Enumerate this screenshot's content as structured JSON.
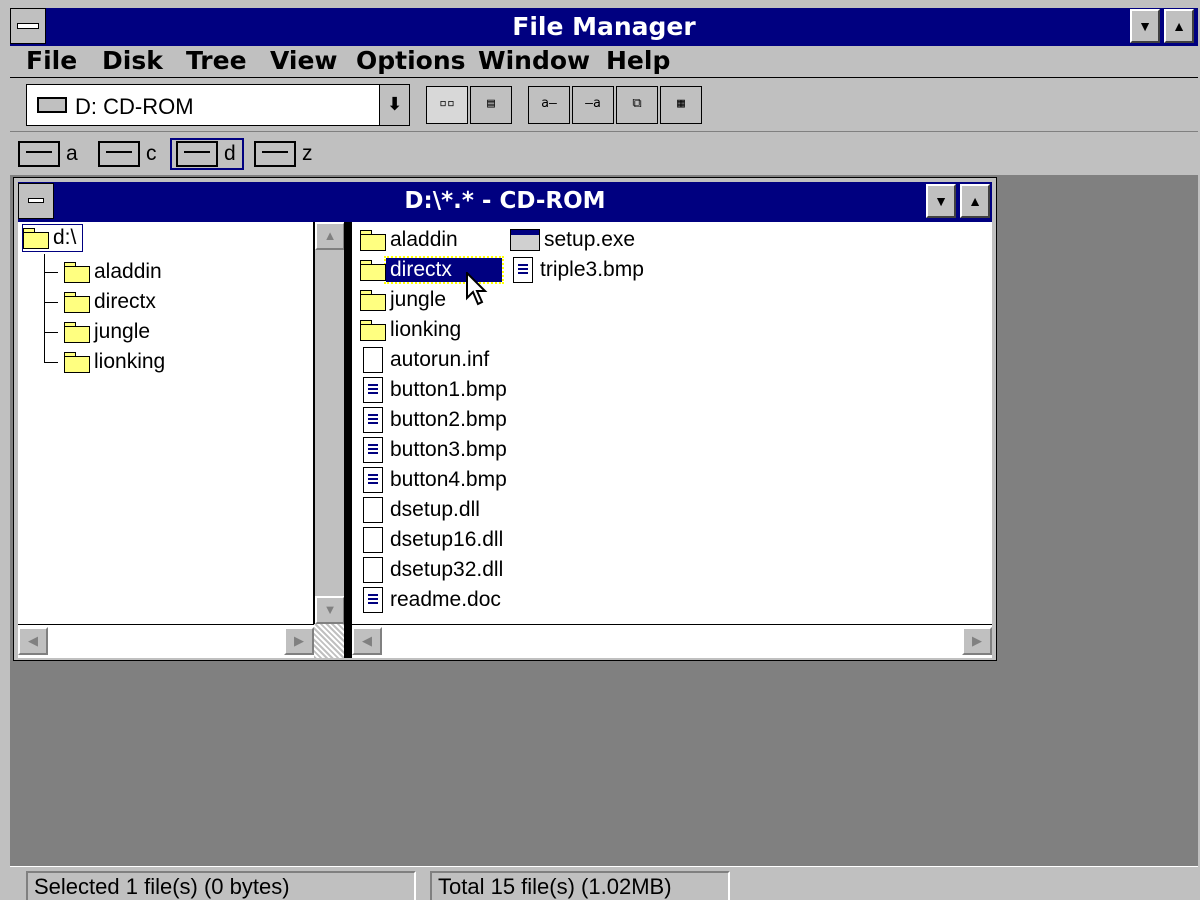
{
  "window": {
    "title": "File Manager"
  },
  "menu": [
    "File",
    "Disk",
    "Tree",
    "View",
    "Options",
    "Window",
    "Help"
  ],
  "toolbar": {
    "drive_select": "D: CD-ROM"
  },
  "drives": [
    {
      "letter": "a",
      "type": "floppy"
    },
    {
      "letter": "c",
      "type": "hard-disk"
    },
    {
      "letter": "d",
      "type": "cd-rom",
      "selected": true
    },
    {
      "letter": "z",
      "type": "network"
    }
  ],
  "child_window": {
    "title": "D:\\*.* - CD-ROM",
    "tree": {
      "root": "d:\\",
      "children": [
        "aladdin",
        "directx",
        "jungle",
        "lionking"
      ]
    },
    "files_col1": [
      {
        "name": "aladdin",
        "icon": "folder-icon"
      },
      {
        "name": "directx",
        "icon": "folder-icon",
        "selected": true
      },
      {
        "name": "jungle",
        "icon": "folder-icon"
      },
      {
        "name": "lionking",
        "icon": "folder-icon"
      },
      {
        "name": "autorun.inf",
        "icon": "file-icon"
      },
      {
        "name": "button1.bmp",
        "icon": "document-icon"
      },
      {
        "name": "button2.bmp",
        "icon": "document-icon"
      },
      {
        "name": "button3.bmp",
        "icon": "document-icon"
      },
      {
        "name": "button4.bmp",
        "icon": "document-icon"
      },
      {
        "name": "dsetup.dll",
        "icon": "file-icon"
      },
      {
        "name": "dsetup16.dll",
        "icon": "file-icon"
      },
      {
        "name": "dsetup32.dll",
        "icon": "file-icon"
      },
      {
        "name": "readme.doc",
        "icon": "document-icon"
      }
    ],
    "files_col2": [
      {
        "name": "setup.exe",
        "icon": "program-icon"
      },
      {
        "name": "triple3.bmp",
        "icon": "document-icon"
      }
    ]
  },
  "status": {
    "selected": "Selected 1 file(s) (0 bytes)",
    "total": "Total 15 file(s) (1.02MB)"
  }
}
